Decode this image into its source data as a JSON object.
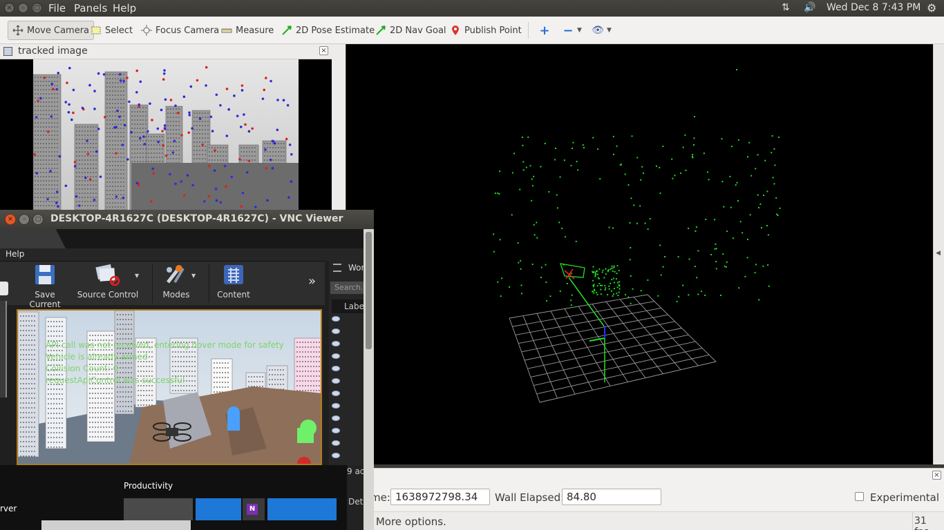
{
  "topbar": {
    "menu": [
      "File",
      "Panels",
      "Help"
    ],
    "clock": "Wed Dec  8  7:43 PM"
  },
  "toolbar": {
    "tools": [
      {
        "label": "Move Camera",
        "icon": "move-camera-icon",
        "active": true
      },
      {
        "label": "Select",
        "icon": "select-icon"
      },
      {
        "label": "Focus Camera",
        "icon": "focus-camera-icon"
      },
      {
        "label": "Measure",
        "icon": "measure-icon"
      },
      {
        "label": "2D Pose Estimate",
        "icon": "pose-estimate-icon"
      },
      {
        "label": "2D Nav Goal",
        "icon": "nav-goal-icon"
      },
      {
        "label": "Publish Point",
        "icon": "publish-point-icon"
      }
    ]
  },
  "image_panel": {
    "title": "tracked image"
  },
  "time_panel": {
    "ros_time_label": "me:",
    "ros_time_value": "1638972798.34",
    "wall_elapsed_label": "Wall Elapsed:",
    "wall_elapsed_value": "84.80",
    "experimental_label": "Experimental",
    "experimental_checked": false,
    "status": ": More options.",
    "fps": "31 fps"
  },
  "vnc": {
    "title": "DESKTOP-4R1627C (DESKTOP-4R1627C) - VNC Viewer",
    "menu_help": "Help",
    "toolbar": [
      {
        "label": "Save Current",
        "icon": "save-icon"
      },
      {
        "label": "Source Control",
        "icon": "source-control-icon"
      },
      {
        "label": "Modes",
        "icon": "modes-icon"
      },
      {
        "label": "Content",
        "icon": "content-icon"
      }
    ],
    "outliner_title": "Wor",
    "search_placeholder": "Search...",
    "label_header": "Labe",
    "actors_count": "9 ac",
    "details": "Deta",
    "overlay_lines": [
      "API call was not received, entering hover mode for safety",
      "Vehicle is already armed",
      "Collision Count: 0",
      "requestApiControl was successful"
    ],
    "taskbar": {
      "productivity": "Productivity",
      "server": "rver"
    }
  },
  "colors": {
    "point_cloud": "#22e022",
    "grid": "#9a9a9a",
    "accent_orange": "#b27b1e",
    "ubuntu_dark": "#3c3b37"
  }
}
